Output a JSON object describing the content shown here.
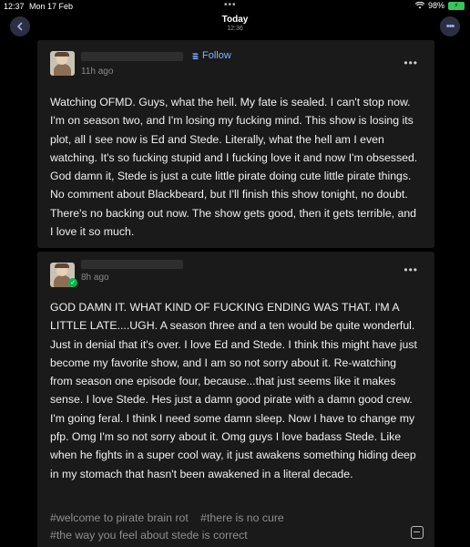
{
  "status_bar": {
    "time": "12:37",
    "date": "Mon 17 Feb",
    "dots": "•••",
    "battery": "98%"
  },
  "header": {
    "title": "Today",
    "subtitle": "12:36",
    "more_icon": "more-icon",
    "back_icon": "chevron-left-icon"
  },
  "posts": [
    {
      "time_ago": "11h ago",
      "follow_label": "Follow",
      "menu": "•••",
      "text": "Watching OFMD. Guys, what the hell. My fate is sealed. I can't stop now. I'm on season two, and I'm losing my fucking mind. This show is losing its plot, all I see now is Ed and Stede. Literally, what the hell am I even watching. It's so fucking stupid and I fucking love it and now I'm obsessed. God damn it, Stede is just a cute little pirate doing cute little pirate things. No comment about Blackbeard, but I'll finish this show tonight, no doubt. There's no backing out now. The show gets good, then it gets terrible, and I love it so much."
    },
    {
      "time_ago": "8h ago",
      "menu": "•••",
      "text": "GOD DAMN IT. WHAT KIND OF FUCKING ENDING WAS THAT. I'M A LITTLE LATE....UGH. A season three and a ten would be quite wonderful. Just in denial that it's over. I love Ed and Stede. I think this might have just become my favorite show, and I am so not sorry about it. Re-watching from season one episode four, because...that just seems like it makes sense. I love Stede. Hes just a damn good pirate with a damn good crew. I'm going feral. I think I need some damn sleep. Now I have to change my pfp. Omg I'm so not sorry about it. Omg guys I love badass Stede. Like when he fights in a super cool way, it just awakens something hiding deep in my stomach that hasn't been awakened in a literal decade.",
      "tags": [
        "#welcome to pirate brain rot",
        "#there is no cure",
        "#the way you feel about stede is correct"
      ]
    }
  ]
}
